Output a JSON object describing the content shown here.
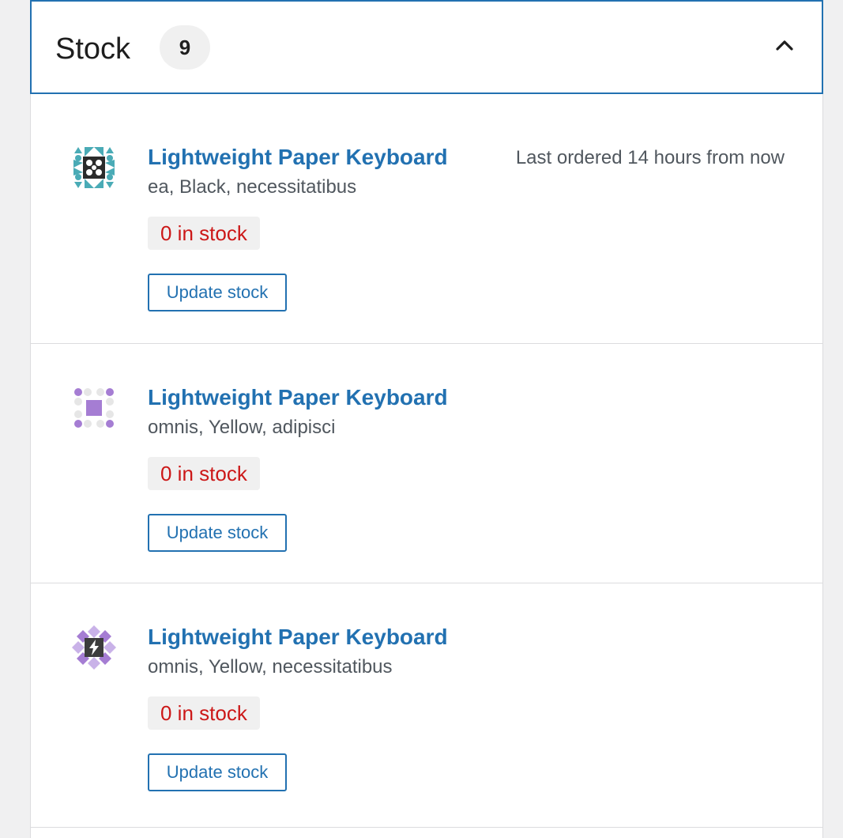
{
  "panel": {
    "title": "Stock",
    "count": "9",
    "collapse_icon": "chevron-up-icon"
  },
  "items": [
    {
      "name": "Lightweight Paper Keyboard",
      "attributes": "ea, Black, necessitatibus",
      "last_ordered": "Last ordered 14 hours from now",
      "stock": "0 in stock",
      "button_label": "Update stock",
      "image_icon": "teal-quilt-pattern-icon"
    },
    {
      "name": "Lightweight Paper Keyboard",
      "attributes": "omnis, Yellow, adipisci",
      "last_ordered": "",
      "stock": "0 in stock",
      "button_label": "Update stock",
      "image_icon": "purple-dot-pattern-icon"
    },
    {
      "name": "Lightweight Paper Keyboard",
      "attributes": "omnis, Yellow, necessitatibus",
      "last_ordered": "",
      "stock": "0 in stock",
      "button_label": "Update stock",
      "image_icon": "lavender-diamond-pattern-icon"
    }
  ],
  "colors": {
    "accent": "#2271b1",
    "out_of_stock": "#cc1818",
    "muted_text": "#50575e"
  }
}
